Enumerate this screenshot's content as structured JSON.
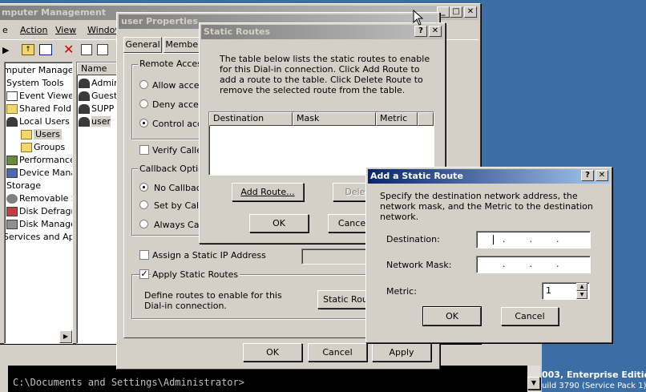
{
  "cm": {
    "title": "mputer Management",
    "menu": [
      "e",
      "Action",
      "View",
      "Window"
    ],
    "tree": [
      {
        "label": "mputer Managem"
      },
      {
        "label": "System Tools"
      },
      {
        "label": "Event Viewe"
      },
      {
        "label": "Shared Fold"
      },
      {
        "label": "Local Users"
      },
      {
        "label": "Users"
      },
      {
        "label": "Groups"
      },
      {
        "label": "Performance"
      },
      {
        "label": "Device Mana"
      },
      {
        "label": "Storage"
      },
      {
        "label": "Removable S"
      },
      {
        "label": "Disk Defragr"
      },
      {
        "label": "Disk Manage"
      },
      {
        "label": "Services and Ap"
      }
    ],
    "list_header": "Name",
    "list_items": [
      "Admin",
      "Guest",
      "SUPP",
      "user"
    ]
  },
  "props": {
    "title": "user Properties",
    "tabs": [
      "General",
      "Member"
    ],
    "remote_access_label": "Remote Access",
    "ra_options": [
      "Allow acces",
      "Deny acces",
      "Control acce"
    ],
    "verify_caller": "Verify Calle",
    "callback_label": "Callback Optio",
    "cb_options": [
      "No Callback",
      "Set by Calle",
      "Always Call"
    ],
    "assign_ip": "Assign a Static IP Address",
    "apply_routes": "Apply Static Routes",
    "routes_desc": "Define routes to enable for this Dial-in connection.",
    "static_routes_btn": "Static Rou",
    "ok": "OK",
    "cancel": "Cancel",
    "apply": "Apply"
  },
  "static_routes": {
    "title": "Static Routes",
    "help": "?",
    "desc": "The table below lists the static routes to enable for this Dial-in connection. Click Add Route to add a route to the table. Click Delete Route to remove the selected route from the table.",
    "columns": [
      "Destination",
      "Mask",
      "Metric"
    ],
    "add_route": "Add Route...",
    "delete_route": "Delet",
    "ok": "OK",
    "cancel": "Cance"
  },
  "add_route": {
    "title": "Add a Static Route",
    "help": "?",
    "desc": "Specify the destination network address, the network mask, and the Metric to the destination network.",
    "destination_label": "Destination:",
    "mask_label": "Network Mask:",
    "metric_label": "Metric:",
    "metric_value": "1",
    "ok": "OK",
    "cancel": "Cancel"
  },
  "console": {
    "prompt": "C:\\Documents and Settings\\Administrator>"
  },
  "desktop": {
    "os_line1": "003, Enterprise Edition",
    "os_line2": "uild 3790 (Service Pack 1)"
  }
}
